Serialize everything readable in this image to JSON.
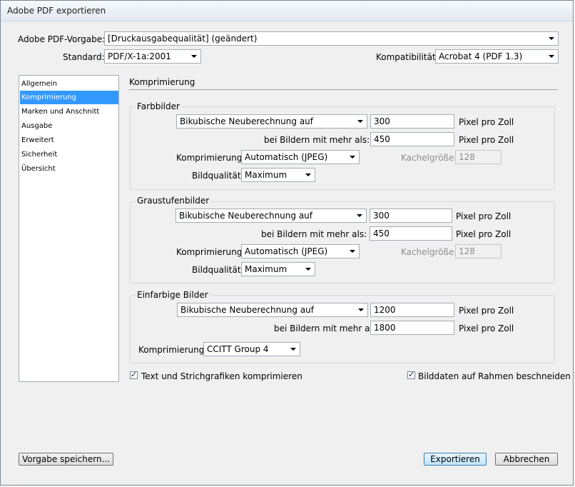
{
  "window": {
    "title": "Adobe PDF exportieren"
  },
  "top": {
    "preset_label": "Adobe PDF-Vorgabe:",
    "preset_value": "[Druckausgabequalität] (geändert)",
    "standard_label": "Standard:",
    "standard_value": "PDF/X-1a:2001",
    "compat_label": "Kompatibilität:",
    "compat_value": "Acrobat 4 (PDF 1.3)"
  },
  "sidebar": {
    "items": [
      {
        "label": "Allgemein"
      },
      {
        "label": "Komprimierung"
      },
      {
        "label": "Marken und Anschnitt"
      },
      {
        "label": "Ausgabe"
      },
      {
        "label": "Erweitert"
      },
      {
        "label": "Sicherheit"
      },
      {
        "label": "Übersicht"
      }
    ],
    "selected_index": 1
  },
  "section": {
    "title": "Komprimierung"
  },
  "color": {
    "title": "Farbbilder",
    "resample": "Bikubische Neuberechnung auf",
    "ppi": "300",
    "ppi_unit": "Pixel pro Zoll",
    "above_label": "bei Bildern mit mehr als:",
    "above": "450",
    "above_unit": "Pixel pro Zoll",
    "compression_label": "Komprimierung:",
    "compression": "Automatisch (JPEG)",
    "tile_label": "Kachelgröße:",
    "tile": "128",
    "quality_label": "Bildqualität:",
    "quality": "Maximum"
  },
  "gray": {
    "title": "Graustufenbilder",
    "resample": "Bikubische Neuberechnung auf",
    "ppi": "300",
    "ppi_unit": "Pixel pro Zoll",
    "above_label": "bei Bildern mit mehr als:",
    "above": "450",
    "above_unit": "Pixel pro Zoll",
    "compression_label": "Komprimierung:",
    "compression": "Automatisch (JPEG)",
    "tile_label": "Kachelgröße:",
    "tile": "128",
    "quality_label": "Bildqualität:",
    "quality": "Maximum"
  },
  "mono": {
    "title": "Einfarbige Bilder",
    "resample": "Bikubische Neuberechnung auf",
    "ppi": "1200",
    "ppi_unit": "Pixel pro Zoll",
    "above_label": "bei Bildern mit mehr als:",
    "above": "1800",
    "above_unit": "Pixel pro Zoll",
    "compression_label": "Komprimierung:",
    "compression": "CCITT Group 4"
  },
  "options": {
    "text_compress": "Text und Strichgrafiken komprimieren",
    "text_compress_checked": true,
    "crop": "Bilddaten auf Rahmen beschneiden",
    "crop_checked": true
  },
  "buttons": {
    "save_preset": "Vorgabe speichern...",
    "export": "Exportieren",
    "cancel": "Abbrechen"
  },
  "colors": {
    "selection": "#3399ff",
    "default_button_border": "#3c7fb1"
  }
}
